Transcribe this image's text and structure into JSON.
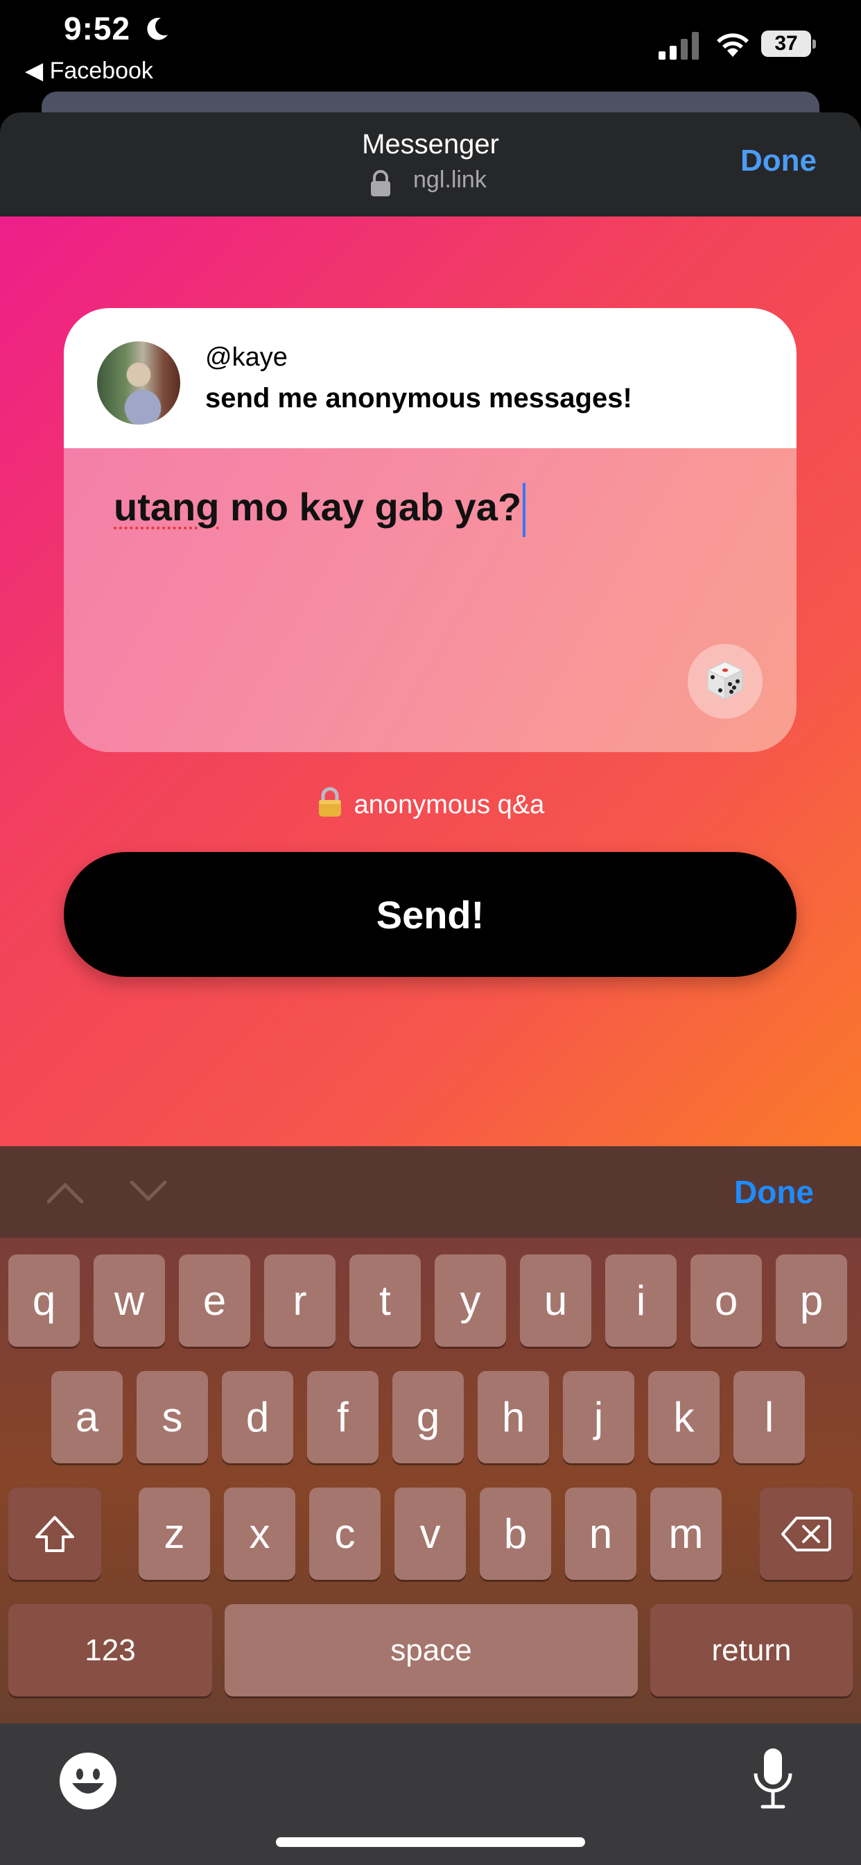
{
  "status_bar": {
    "time": "9:52",
    "back_app": "◀ Facebook",
    "battery": "37"
  },
  "browser_sheet": {
    "title": "Messenger",
    "url": "ngl.link",
    "done_label": "Done"
  },
  "card": {
    "username": "@kaye",
    "prompt": "send me anonymous messages!",
    "message_misspelled_word": "utang",
    "message_rest": " mo kay gab ya?"
  },
  "anonymous_label": "anonymous q&a",
  "send_button_label": "Send!",
  "keyboard": {
    "done_label": "Done",
    "row1": [
      "q",
      "w",
      "e",
      "r",
      "t",
      "y",
      "u",
      "i",
      "o",
      "p"
    ],
    "row2": [
      "a",
      "s",
      "d",
      "f",
      "g",
      "h",
      "j",
      "k",
      "l"
    ],
    "row3": [
      "z",
      "x",
      "c",
      "v",
      "b",
      "n",
      "m"
    ],
    "numbers_label": "123",
    "space_label": "space",
    "return_label": "return"
  },
  "colors": {
    "accent_blue": "#4b9cf5",
    "keyboard_done": "#1e8cff",
    "gradient_start": "#ee1e8a",
    "gradient_end": "#fa7a2a"
  },
  "icons": [
    "moon-icon",
    "signal-icon",
    "wifi-icon",
    "battery-icon",
    "lock-icon",
    "dice-icon",
    "chevron-up-icon",
    "chevron-down-icon",
    "shift-icon",
    "delete-icon",
    "emoji-icon",
    "microphone-icon"
  ]
}
